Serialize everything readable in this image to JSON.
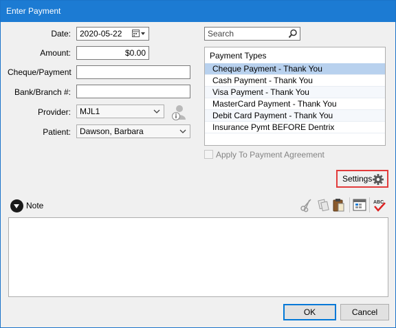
{
  "window": {
    "title": "Enter Payment"
  },
  "form": {
    "date": {
      "label": "Date:",
      "value": "2020-05-22"
    },
    "amount": {
      "label": "Amount:",
      "value": "$0.00"
    },
    "cheque": {
      "label": "Cheque/Payment",
      "value": ""
    },
    "bank": {
      "label": "Bank/Branch #:",
      "value": ""
    },
    "provider": {
      "label": "Provider:",
      "value": "MJL1"
    },
    "patient": {
      "label": "Patient:",
      "value": "Dawson, Barbara"
    }
  },
  "search": {
    "placeholder": "Search"
  },
  "payment_types": {
    "header": "Payment Types",
    "items": [
      "Cheque Payment - Thank You",
      "Cash Payment - Thank You",
      "Visa Payment - Thank You",
      "MasterCard Payment - Thank You",
      "Debit Card Payment - Thank You",
      "Insurance Pymt BEFORE Dentrix"
    ],
    "selected_index": 0
  },
  "apply_agreement": {
    "label": "Apply To Payment Agreement",
    "checked": false,
    "enabled": false
  },
  "settings": {
    "label": "Settings",
    "icon": "gear-icon"
  },
  "note": {
    "label": "Note",
    "value": ""
  },
  "toolbar": {
    "icons": [
      "cut-icon",
      "copy-icon",
      "paste-icon",
      "date-stamp-icon",
      "spell-check-icon"
    ]
  },
  "buttons": {
    "ok": "OK",
    "cancel": "Cancel"
  },
  "colors": {
    "titlebar": "#1c7bd3",
    "selection": "#b8d1ee",
    "settings_highlight": "#e23a3a"
  }
}
